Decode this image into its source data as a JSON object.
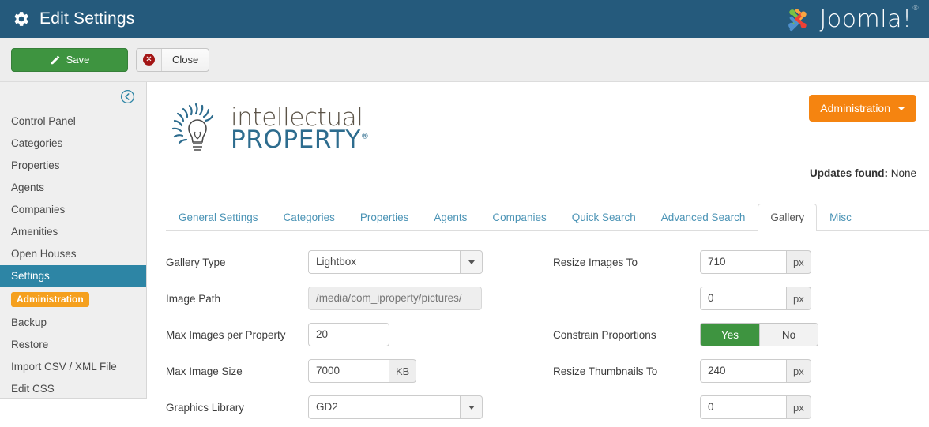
{
  "header": {
    "gear_icon": "gear-icon",
    "title": "Edit Settings",
    "brand": "Joomla!",
    "brand_reg": "®"
  },
  "toolbar": {
    "save_label": "Save",
    "save_icon": "edit-pencil-icon",
    "close_label": "Close",
    "close_icon": "close-circle-icon"
  },
  "sidebar": {
    "collapse_icon": "circle-left-arrow-icon",
    "items": [
      {
        "label": "Control Panel",
        "active": false
      },
      {
        "label": "Categories",
        "active": false
      },
      {
        "label": "Properties",
        "active": false
      },
      {
        "label": "Agents",
        "active": false
      },
      {
        "label": "Companies",
        "active": false
      },
      {
        "label": "Amenities",
        "active": false
      },
      {
        "label": "Open Houses",
        "active": false
      },
      {
        "label": "Settings",
        "active": true
      }
    ],
    "badge_label": "Administration",
    "sub_items": [
      {
        "label": "Backup"
      },
      {
        "label": "Restore"
      },
      {
        "label": "Import CSV / XML File"
      },
      {
        "label": "Edit CSS"
      }
    ]
  },
  "brand": {
    "line1": "intellectual",
    "line2": "PROPERTY",
    "reg": "®",
    "logo_icon": "lightbulb-sun-icon"
  },
  "admin": {
    "button_label": "Administration",
    "caret_icon": "caret-down-icon",
    "updates_label": "Updates found:",
    "updates_value": "None"
  },
  "tabs": [
    {
      "label": "General Settings",
      "active": false
    },
    {
      "label": "Categories",
      "active": false
    },
    {
      "label": "Properties",
      "active": false
    },
    {
      "label": "Agents",
      "active": false
    },
    {
      "label": "Companies",
      "active": false
    },
    {
      "label": "Quick Search",
      "active": false
    },
    {
      "label": "Advanced Search",
      "active": false
    },
    {
      "label": "Gallery",
      "active": true
    },
    {
      "label": "Misc",
      "active": false
    }
  ],
  "form": {
    "left": {
      "gallery_type_label": "Gallery Type",
      "gallery_type_value": "Lightbox",
      "image_path_label": "Image Path",
      "image_path_value": "/media/com_iproperty/pictures/",
      "max_images_label": "Max Images per Property",
      "max_images_value": "20",
      "max_size_label": "Max Image Size",
      "max_size_value": "7000",
      "max_size_unit": "KB",
      "graphics_lib_label": "Graphics Library",
      "graphics_lib_value": "GD2"
    },
    "right": {
      "resize_images_label": "Resize Images To",
      "resize_images_w": "710",
      "resize_images_unit_w": "px",
      "resize_images_h": "0",
      "resize_images_unit_h": "px",
      "constrain_label": "Constrain Proportions",
      "constrain_yes": "Yes",
      "constrain_no": "No",
      "resize_thumbs_label": "Resize Thumbnails To",
      "resize_thumbs_w": "240",
      "resize_thumbs_unit_w": "px",
      "resize_thumbs_h": "0",
      "resize_thumbs_unit_h": "px"
    }
  },
  "colors": {
    "header_blue": "#255a7c",
    "active_nav": "#2d85a5",
    "save_green": "#3e9440",
    "admin_orange": "#f58410",
    "badge_orange": "#f5a01e",
    "tab_link": "#4a93b5",
    "brand_blue": "#2d6c8e",
    "brand_brown": "#5b5347",
    "close_red": "#a31515"
  }
}
